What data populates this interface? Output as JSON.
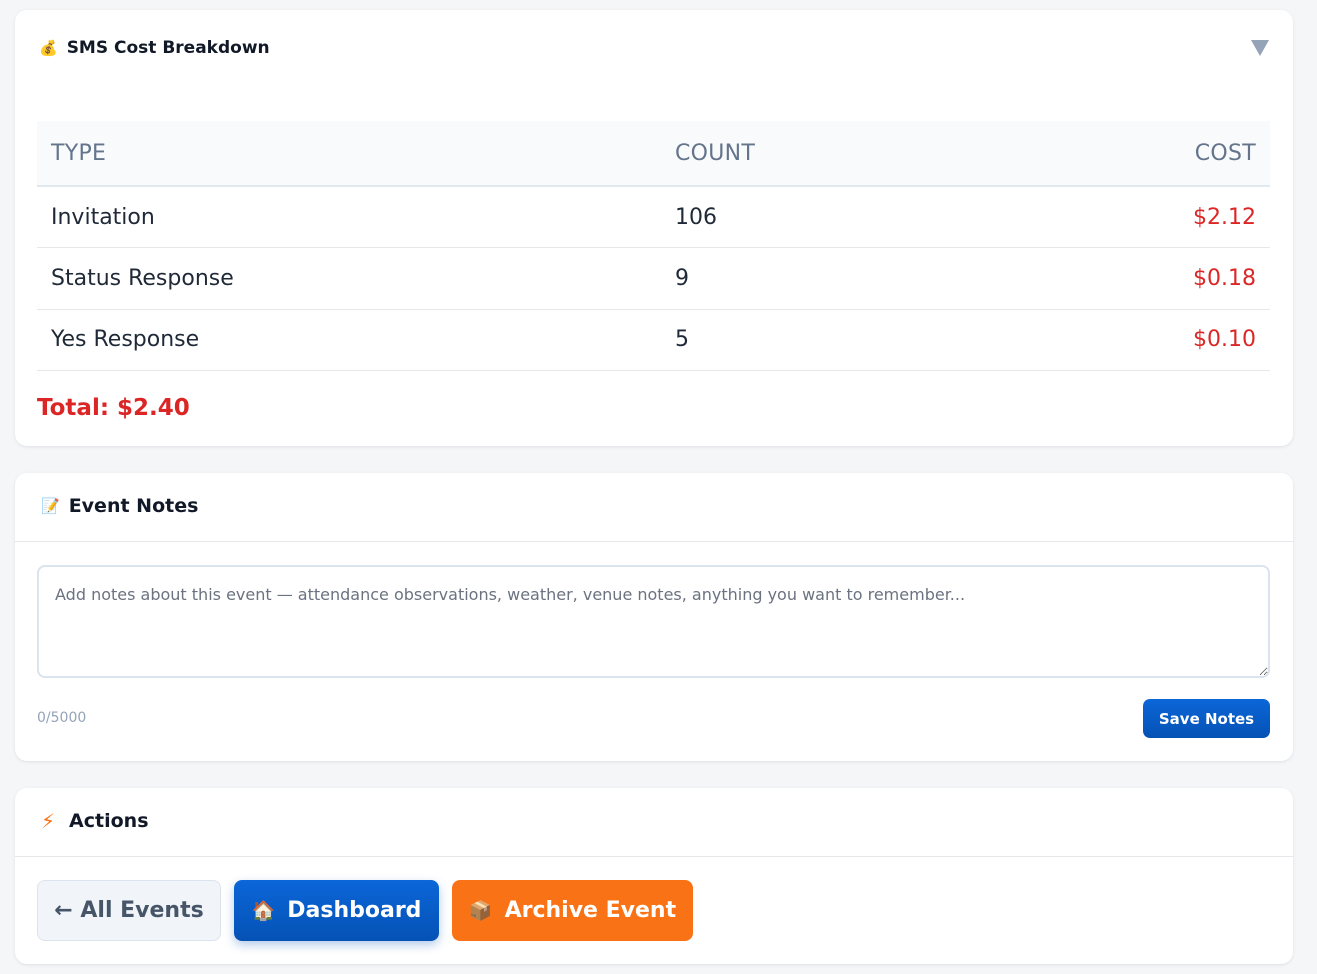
{
  "cost_breakdown": {
    "icon": "money-bag-icon",
    "icon_glyph": "💰",
    "title": "SMS Cost Breakdown",
    "collapse_icon": "chevron-down-icon",
    "columns": [
      "TYPE",
      "COUNT",
      "COST"
    ],
    "rows": [
      {
        "type": "Invitation",
        "count": "106",
        "cost": "$2.12"
      },
      {
        "type": "Status Response",
        "count": "9",
        "cost": "$0.18"
      },
      {
        "type": "Yes Response",
        "count": "5",
        "cost": "$0.10"
      }
    ],
    "total": "Total: $2.40",
    "cost_color": "#dc2626"
  },
  "event_notes": {
    "icon": "memo-icon",
    "icon_glyph": "📝",
    "title": "Event Notes",
    "placeholder": "Add notes about this event — attendance observations, weather, venue notes, anything you want to remember...",
    "value": "",
    "char_count": "0/5000",
    "save_label": "Save Notes"
  },
  "actions": {
    "icon": "lightning-icon",
    "icon_glyph": "⚡",
    "title": "Actions",
    "buttons": {
      "all_events": "← All Events",
      "dashboard_icon": "🏠",
      "dashboard": "Dashboard",
      "archive_icon": "📦",
      "archive": "Archive Event"
    },
    "colors": {
      "primary": "#0552b5",
      "archive": "#f97316"
    }
  }
}
